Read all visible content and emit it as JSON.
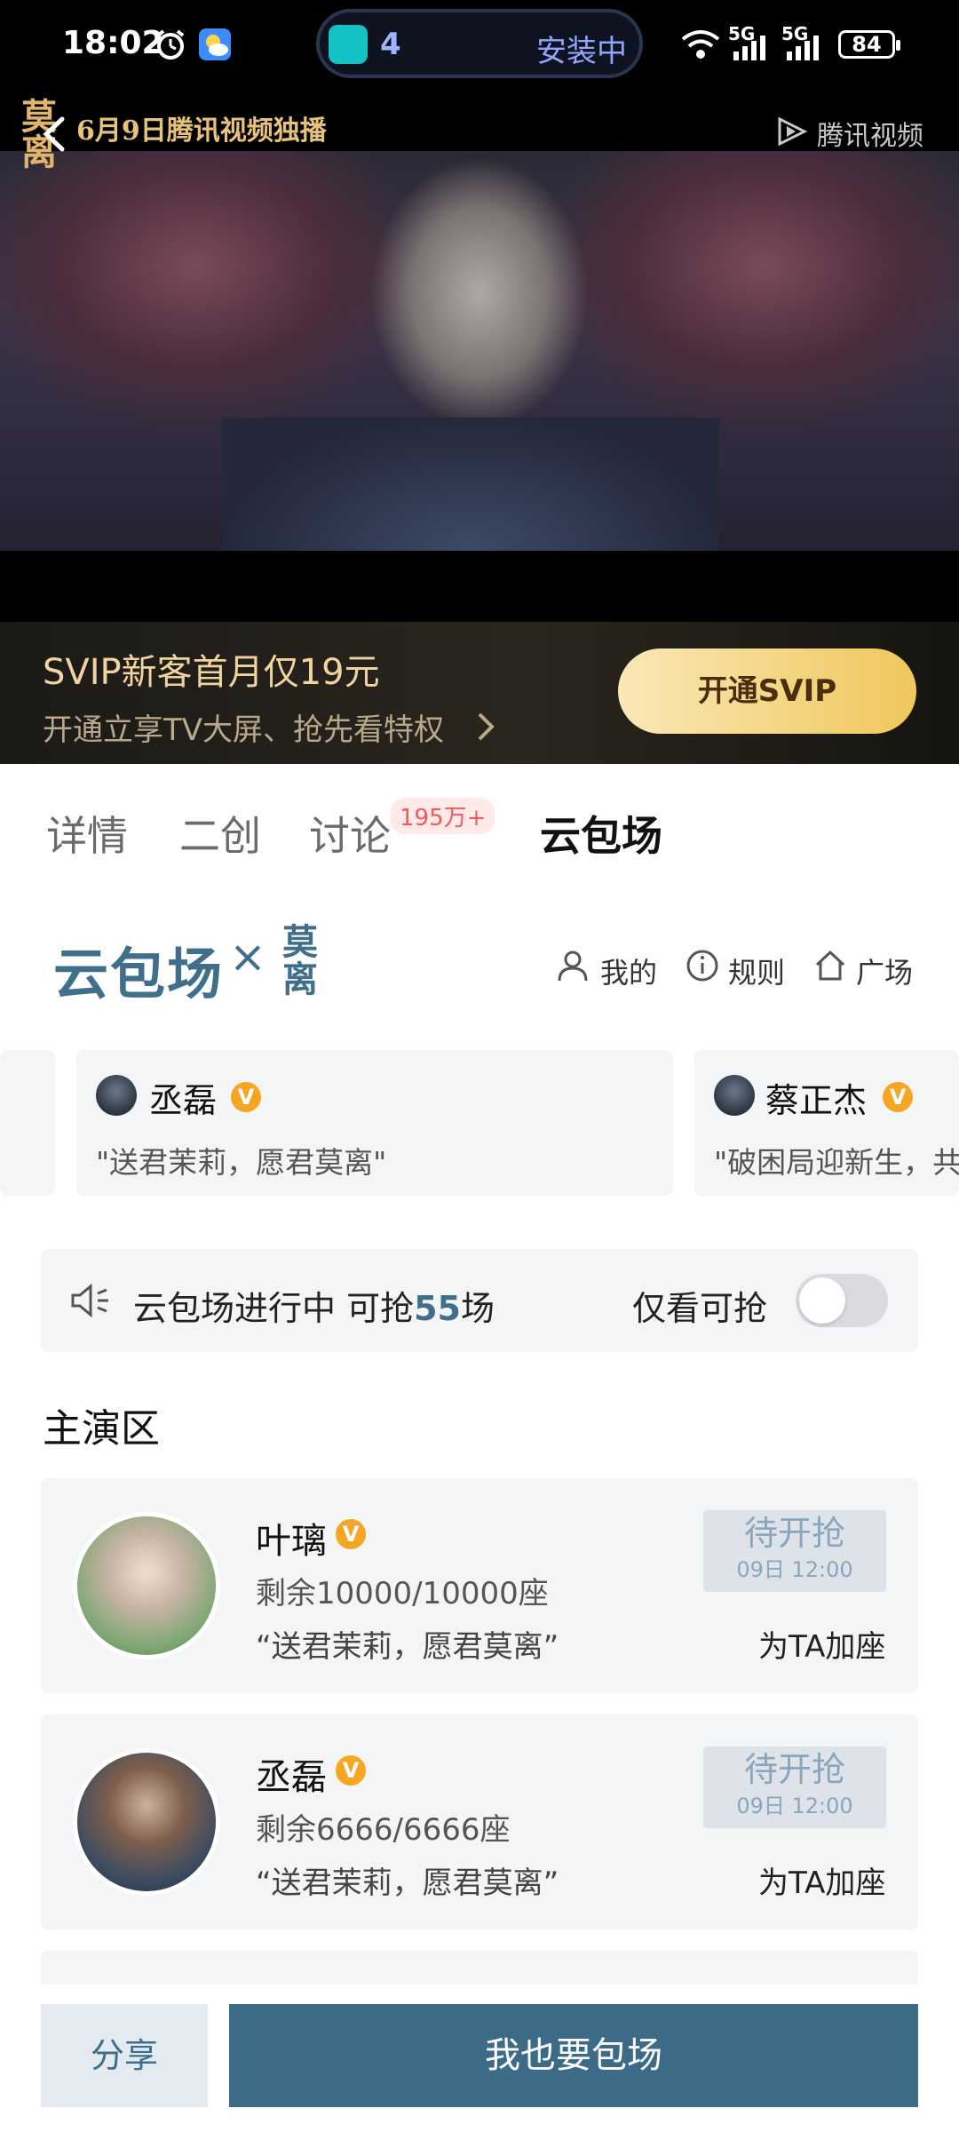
{
  "status_bar": {
    "time": "18:02",
    "download_count": "4",
    "download_status": "安装中",
    "network_1": "5G",
    "network_2": "5G",
    "battery": "84"
  },
  "video": {
    "promo_logo": "莫离",
    "promo_text": "6月9日腾讯视频独播",
    "watermark": "腾讯视频"
  },
  "svip": {
    "title": "SVIP新客首月仅19元",
    "subtitle": "开通立享TV大屏、抢先看特权",
    "button": "开通SVIP"
  },
  "tabs": [
    {
      "label": "详情",
      "active": false
    },
    {
      "label": "二创",
      "active": false
    },
    {
      "label": "讨论",
      "badge": "195万+",
      "active": false
    },
    {
      "label": "云包场",
      "active": true
    }
  ],
  "brand": {
    "name": "云包场",
    "cross": "×",
    "drama": "莫离",
    "links": [
      "我的",
      "规则",
      "广场"
    ]
  },
  "celebrities": [
    {
      "name": "丞磊",
      "verified": "V",
      "quote": "\"送君茉莉，愿君莫离\""
    },
    {
      "name": "蔡正杰",
      "verified": "V",
      "quote": "\"破困局迎新生，共"
    }
  ],
  "status": {
    "text_before": "云包场进行中 可抢",
    "count": "55",
    "text_after": "场",
    "only_available": "仅看可抢",
    "toggle_on": false
  },
  "section_title": "主演区",
  "list": [
    {
      "name": "叶璃",
      "verified": "V",
      "remaining": "剩余10000/10000座",
      "quote": "“送君茉莉，愿君莫离”",
      "state": "待开抢",
      "time": "09日 12:00",
      "action": "为TA加座"
    },
    {
      "name": "丞磊",
      "verified": "V",
      "remaining": "剩余6666/6666座",
      "quote": "“送君茉莉，愿君莫离”",
      "state": "待开抢",
      "time": "09日 12:00",
      "action": "为TA加座"
    }
  ],
  "bottom": {
    "share": "分享",
    "main": "我也要包场"
  },
  "colors": {
    "accent": "#3f6f8a",
    "svip_gold": "#f0c75b",
    "badge_red": "#f05a5a",
    "verified": "#f6a623"
  }
}
